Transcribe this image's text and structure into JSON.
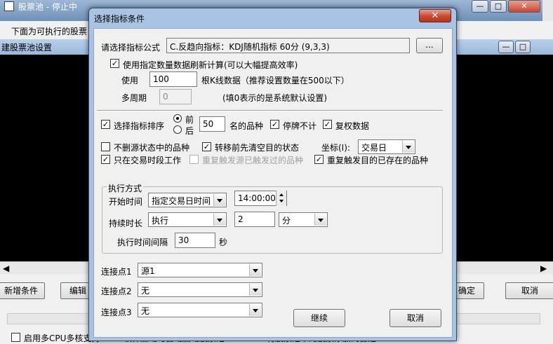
{
  "background": {
    "app_title": "股票池 - 停止中",
    "panel_text": "下面为可执行的股票",
    "dialog2_title": "建股票池设置",
    "buttons": [
      "新增条件",
      "编辑",
      "确定",
      "取消"
    ],
    "status_items": [
      "启用多CPU多核支持",
      "软件启动时自动启动股票池",
      "将股票池中的股票添加到自选"
    ],
    "right_edge_char": "%"
  },
  "dialog": {
    "title": "选择指标条件",
    "close_label": "✕",
    "formula_label": "请选择指标公式",
    "formula_value": "C.反趋向指标：KDJ随机指标 60分 (9,3,3)",
    "browse_label": "...",
    "use_count_label": "使用指定数量数据刷新计算(可以大幅提高效率)",
    "use_label": "使用",
    "use_value": "100",
    "kline_label": "根K线数据（推荐设置数量在500以下）",
    "period_label": "多周期",
    "period_value": "0",
    "period_hint": "(填0表示的是系统默认设置)",
    "sort_label": "选择指标排序",
    "radio_front": "前",
    "radio_back": "后",
    "sort_value": "50",
    "rank_label": "名的品种",
    "suspend_label": "停牌不计",
    "adjust_label": "复权数据",
    "no_delete_label": "不删源状态中的品种",
    "clear_target_label": "转移前先清空目的状态",
    "coord_label": "坐标(I):",
    "coord_value": "交易日",
    "trade_time_label": "只在交易时段工作",
    "repeat_src_label": "重复触发源已触发过的品种",
    "repeat_dst_label": "重复触发目的已存在的品种",
    "exec_group_label": "执行方式",
    "start_time_label": "开始时间",
    "start_mode_value": "指定交易日时间",
    "start_time_value": "14:00:00",
    "duration_label": "持续时长",
    "duration_mode_value": "执行",
    "duration_value": "2",
    "duration_unit_value": "分",
    "interval_label": "执行时间间隔",
    "interval_value": "30",
    "interval_unit": "秒",
    "conn1_label": "连接点1",
    "conn1_value": "源1",
    "conn2_label": "连接点2",
    "conn2_value": "无",
    "conn3_label": "连接点3",
    "conn3_value": "无",
    "continue_label": "继续",
    "cancel_label": "取消",
    "checked": {
      "use_count": true,
      "sort": true,
      "suspend": true,
      "adjust": true,
      "no_delete": false,
      "clear_target": true,
      "trade_time": true,
      "repeat_src": false,
      "repeat_dst": true
    }
  }
}
